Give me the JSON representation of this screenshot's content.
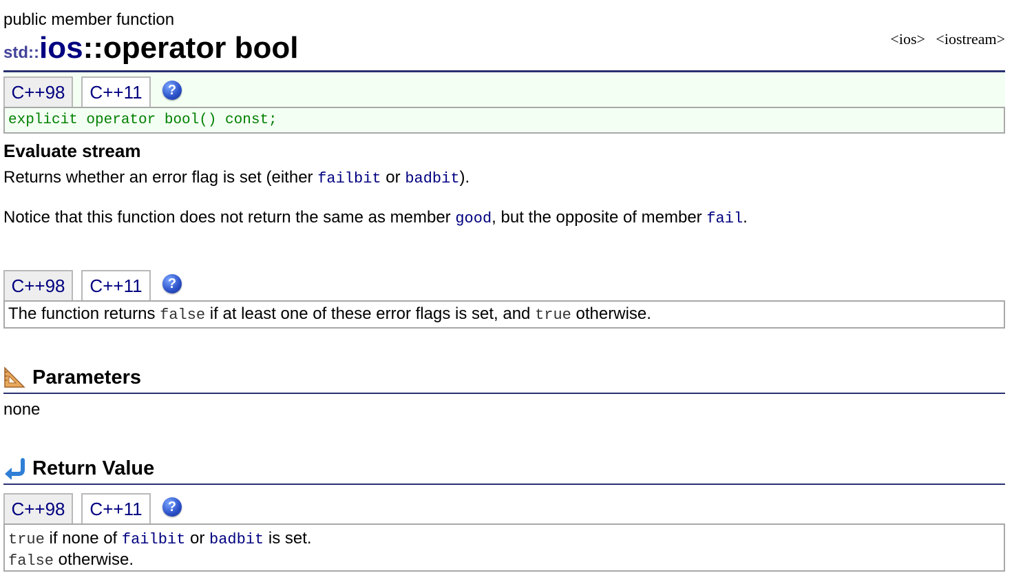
{
  "header": {
    "subtitle": "public member function",
    "namespace": "std::",
    "class_name": "ios",
    "function_name": "::operator bool",
    "header_links": [
      "<ios>",
      "<iostream>"
    ]
  },
  "tabs": {
    "c98": "C++98",
    "c11": "C++11",
    "help": "?"
  },
  "declaration": "explicit operator bool() const;",
  "summary_title": "Evaluate stream",
  "para1": {
    "t1": "Returns whether an error flag is set (either ",
    "k1": "failbit",
    "t2": " or ",
    "k2": "badbit",
    "t3": ")."
  },
  "para2": {
    "t1": "Notice that this function does not return the same as member ",
    "k1": "good",
    "t2": ", but the opposite of member ",
    "k2": "fail",
    "t3": "."
  },
  "c11_note": {
    "t1": "The function returns ",
    "k1": "false",
    "t2": " if at least one of these error flags is set, and ",
    "k2": "true",
    "t3": " otherwise."
  },
  "parameters": {
    "title": "Parameters",
    "icon": "ruler-triangle-icon",
    "body": "none"
  },
  "return_value": {
    "title": "Return Value",
    "icon": "return-arrow-icon",
    "line1": {
      "k1": "true",
      "t1": " if none of ",
      "k2": "failbit",
      "t2": " or ",
      "k3": "badbit",
      "t3": " is set."
    },
    "line2": {
      "k1": "false",
      "t1": " otherwise."
    }
  },
  "colors": {
    "navy": "#000080",
    "rule": "#283071",
    "decl_green": "#008000",
    "decl_bg": "#f4fff4"
  }
}
